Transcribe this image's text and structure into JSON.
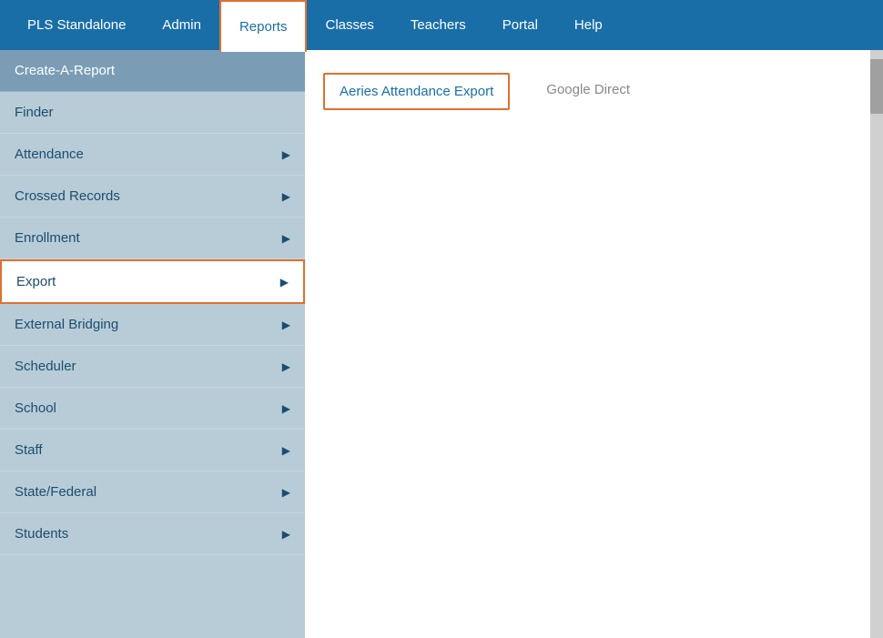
{
  "nav": {
    "items": [
      {
        "id": "pls-standalone",
        "label": "PLS Standalone",
        "active": false
      },
      {
        "id": "admin",
        "label": "Admin",
        "active": false
      },
      {
        "id": "reports",
        "label": "Reports",
        "active": true
      },
      {
        "id": "classes",
        "label": "Classes",
        "active": false
      },
      {
        "id": "teachers",
        "label": "Teachers",
        "active": false
      },
      {
        "id": "portal",
        "label": "Portal",
        "active": false
      },
      {
        "id": "help",
        "label": "Help",
        "active": false
      }
    ]
  },
  "sidebar": {
    "items": [
      {
        "id": "create-a-report",
        "label": "Create-A-Report",
        "hasArrow": false,
        "active": true,
        "highlighted": false
      },
      {
        "id": "finder",
        "label": "Finder",
        "hasArrow": false,
        "active": false,
        "highlighted": false
      },
      {
        "id": "attendance",
        "label": "Attendance",
        "hasArrow": true,
        "active": false,
        "highlighted": false
      },
      {
        "id": "crossed-records",
        "label": "Crossed Records",
        "hasArrow": true,
        "active": false,
        "highlighted": false
      },
      {
        "id": "enrollment",
        "label": "Enrollment",
        "hasArrow": true,
        "active": false,
        "highlighted": false
      },
      {
        "id": "export",
        "label": "Export",
        "hasArrow": true,
        "active": false,
        "highlighted": true
      },
      {
        "id": "external-bridging",
        "label": "External Bridging",
        "hasArrow": true,
        "active": false,
        "highlighted": false
      },
      {
        "id": "scheduler",
        "label": "Scheduler",
        "hasArrow": true,
        "active": false,
        "highlighted": false
      },
      {
        "id": "school",
        "label": "School",
        "hasArrow": true,
        "active": false,
        "highlighted": false
      },
      {
        "id": "staff",
        "label": "Staff",
        "hasArrow": true,
        "active": false,
        "highlighted": false
      },
      {
        "id": "state-federal",
        "label": "State/Federal",
        "hasArrow": true,
        "active": false,
        "highlighted": false
      },
      {
        "id": "students",
        "label": "Students",
        "hasArrow": true,
        "active": false,
        "highlighted": false
      }
    ]
  },
  "content": {
    "items": [
      {
        "id": "aeries-attendance-export",
        "label": "Aeries Attendance Export",
        "highlighted": true
      },
      {
        "id": "google-direct",
        "label": "Google Direct",
        "highlighted": false
      }
    ]
  }
}
